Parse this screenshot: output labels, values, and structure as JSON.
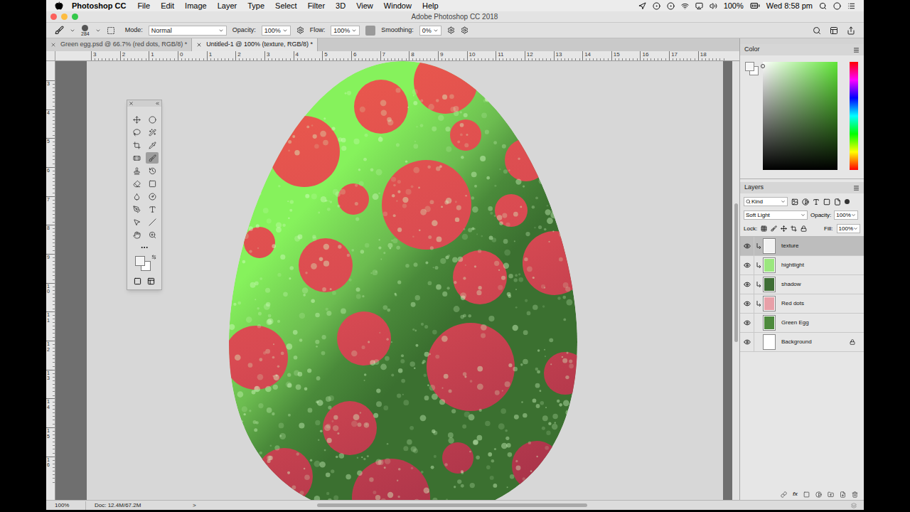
{
  "menu_bar": {
    "app": "Photoshop CC",
    "items": [
      "File",
      "Edit",
      "Image",
      "Layer",
      "Type",
      "Select",
      "Filter",
      "3D",
      "View",
      "Window",
      "Help"
    ],
    "battery": "100%",
    "clock": "Wed 8:58 pm"
  },
  "window": {
    "title": "Adobe Photoshop CC 2018"
  },
  "options_bar": {
    "brush_size": "284",
    "mode_label": "Mode:",
    "mode": "Normal",
    "opacity_label": "Opacity:",
    "opacity": "100%",
    "flow_label": "Flow:",
    "flow": "100%",
    "smoothing_label": "Smoothing:",
    "smoothing": "0%"
  },
  "tabs": [
    {
      "label": "Green egg.psd @ 66.7% (red dots, RGB/8) *",
      "selected": false
    },
    {
      "label": "Untitled-1 @ 100% (texture, RGB/8) *",
      "selected": true
    }
  ],
  "rulers": {
    "horizontal": [
      "3",
      "2",
      "1",
      "0",
      "1",
      "2",
      "3",
      "4",
      "5",
      "6",
      "7",
      "8",
      "9",
      "10",
      "11",
      "12",
      "13",
      "14",
      "15",
      "16",
      "17",
      "18"
    ],
    "vertical": [
      "3",
      "4",
      "5",
      "6",
      "7",
      "8",
      "9",
      "10",
      "11",
      "12",
      "13",
      "14",
      "15",
      "16"
    ]
  },
  "tools": [
    {
      "selected": false
    },
    {
      "selected": false
    },
    {
      "selected": false
    },
    {
      "selected": false
    },
    {
      "selected": false
    },
    {
      "selected": false
    },
    {
      "selected": false
    },
    {
      "selected": true
    },
    {
      "selected": false
    },
    {
      "selected": false
    },
    {
      "selected": false
    },
    {
      "selected": false
    },
    {
      "selected": false
    },
    {
      "selected": false
    },
    {
      "selected": false
    },
    {
      "selected": false
    },
    {
      "selected": false
    },
    {
      "selected": false
    },
    {
      "selected": false
    },
    {
      "selected": false
    }
  ],
  "color_panel": {
    "title": "Color"
  },
  "layers_panel": {
    "title": "Layers",
    "filter": "Kind",
    "blend_mode": "Soft Light",
    "opacity_label": "Opacity:",
    "opacity": "100%",
    "lock_label": "Lock:",
    "fill_label": "Fill:",
    "fill": "100%",
    "footer_fx": "fx",
    "layers": [
      {
        "name": "texture",
        "selected": true,
        "visible": true,
        "clipped": true,
        "locked": false,
        "color": "#f2f2f2"
      },
      {
        "name": "hightlight",
        "selected": false,
        "visible": true,
        "clipped": true,
        "locked": false,
        "color": "#9be77f"
      },
      {
        "name": "shadow",
        "selected": false,
        "visible": true,
        "clipped": true,
        "locked": false,
        "color": "#3f6e35"
      },
      {
        "name": "Red dots",
        "selected": false,
        "visible": true,
        "clipped": true,
        "locked": false,
        "color": "#e8a0a8"
      },
      {
        "name": "Green Egg",
        "selected": false,
        "visible": true,
        "clipped": false,
        "locked": false,
        "color": "#4d8a3c"
      },
      {
        "name": "Background",
        "selected": false,
        "visible": true,
        "clipped": false,
        "locked": true,
        "color": "#ffffff"
      }
    ]
  },
  "status_bar": {
    "zoom": "100%",
    "doc": "Doc: 12.4M/67.2M",
    "arrow": ">"
  }
}
